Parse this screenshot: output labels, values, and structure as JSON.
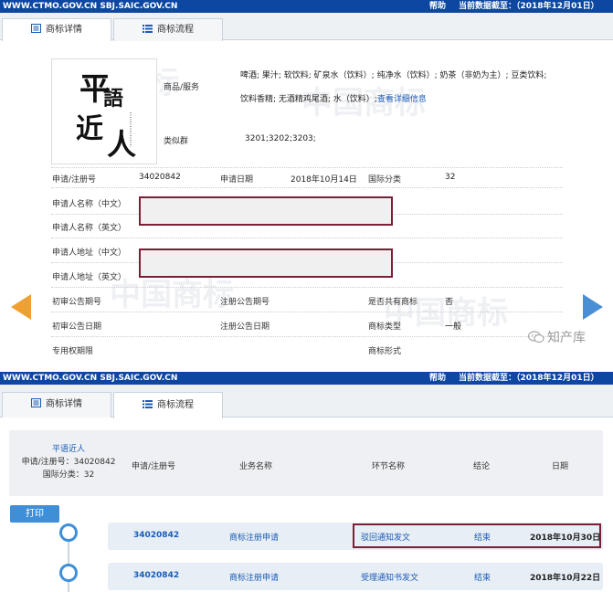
{
  "top_header": {
    "site": "WWW.CTMO.GOV.CN SBJ.SAIC.GOV.CN",
    "help": "帮助",
    "data_date": "当前数据截至：（2018年12月01日）"
  },
  "tabs": [
    {
      "label": "商标详情",
      "icon": "document-icon"
    },
    {
      "label": "商标流程",
      "icon": "list-icon"
    }
  ],
  "trademark": {
    "logo_text": [
      "平",
      "語",
      "近",
      "人"
    ],
    "goods_label": "商品/服务",
    "goods_line1": "啤酒; 果汁; 软饮料; 矿泉水（饮料）; 纯净水（饮料）; 奶茶（非奶为主）; 豆类饮料;",
    "goods_line2": "饮料香精; 无酒精鸡尾酒; 水（饮料）;",
    "view_detail": "查看详细信息",
    "similar_label": "类似群",
    "similar_value": "3201;3202;3203;",
    "reg_no_label": "申请/注册号",
    "reg_no": "34020842",
    "apply_date_label": "申请日期",
    "apply_date": "2018年10月14日",
    "intl_class_label": "国际分类",
    "intl_class": "32",
    "applicant_cn_label": "申请人名称（中文）",
    "applicant_en_label": "申请人名称（英文）",
    "address_cn_label": "申请人地址（中文）",
    "address_en_label": "申请人地址（英文）",
    "prelim_pub_no_label": "初审公告期号",
    "reg_pub_no_label": "注册公告期号",
    "shared_label": "是否共有商标",
    "shared_value": "否",
    "prelim_pub_date_label": "初审公告日期",
    "reg_pub_date_label": "注册公告日期",
    "tm_type_label": "商标类型",
    "tm_type_value": "一般",
    "exclusive_label": "专用权期限",
    "tm_form_label": "商标形式"
  },
  "watermark_text": "中国商标",
  "wechat_label": "知产库",
  "flow": {
    "summary_name": "平语近人",
    "summary_reg": "申请/注册号：34020842",
    "summary_class": "国际分类：32",
    "columns": [
      "申请/注册号",
      "业务名称",
      "环节名称",
      "结论",
      "日期"
    ],
    "print_label": "打印",
    "rows": [
      {
        "reg_no": "34020842",
        "business": "商标注册申请",
        "step": "驳回通知发文",
        "result": "结束",
        "date": "2018年10月30日"
      },
      {
        "reg_no": "34020842",
        "business": "商标注册申请",
        "step": "受理通知书发文",
        "result": "结束",
        "date": "2018年10月22日"
      }
    ]
  },
  "colors": {
    "header_blue": "#0d47a1",
    "accent_blue": "#3f8fd8",
    "highlight_red": "#7a1f35",
    "arrow_orange": "#f0a030"
  }
}
